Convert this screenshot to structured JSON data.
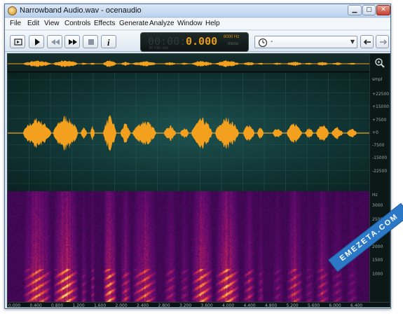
{
  "window": {
    "title": "Narrowband Audio.wav - ocenaudio"
  },
  "menu": [
    "File",
    "Edit",
    "View",
    "Controls",
    "Effects",
    "Generate",
    "Analyze",
    "Window",
    "Help"
  ],
  "display": {
    "inactive_digits": "00:00:0",
    "time": "0.000",
    "labels": "hr   min   sec",
    "sample_rate": "8000 Hz",
    "channel_mode": "mono"
  },
  "selector": {
    "value": "-"
  },
  "waveform": {
    "amplitude_unit": "smpl",
    "amplitude_labels": [
      "+22500",
      "+15000",
      "+7500",
      "+0",
      "-7500",
      "-15000",
      "-22500"
    ]
  },
  "spectrogram": {
    "frequency_unit": "Hz",
    "frequency_labels": [
      "3000",
      "2500",
      "2000",
      "1500",
      "1000"
    ]
  },
  "timeline": {
    "labels": [
      "0.000",
      "0.400",
      "0.800",
      "1.200",
      "1.600",
      "2.000",
      "2.400",
      "2.800",
      "3.200",
      "3.600",
      "4.000",
      "4.400",
      "4.800",
      "5.200",
      "5.600",
      "6.000",
      "6.400"
    ]
  },
  "watermark": {
    "text": "EMEZETA.COM"
  },
  "colors": {
    "waveform": "#f2a01e",
    "spectrum_low": "#1d0436",
    "spectrum_high": "#ffd27a",
    "accent_display": "#e59b16"
  }
}
